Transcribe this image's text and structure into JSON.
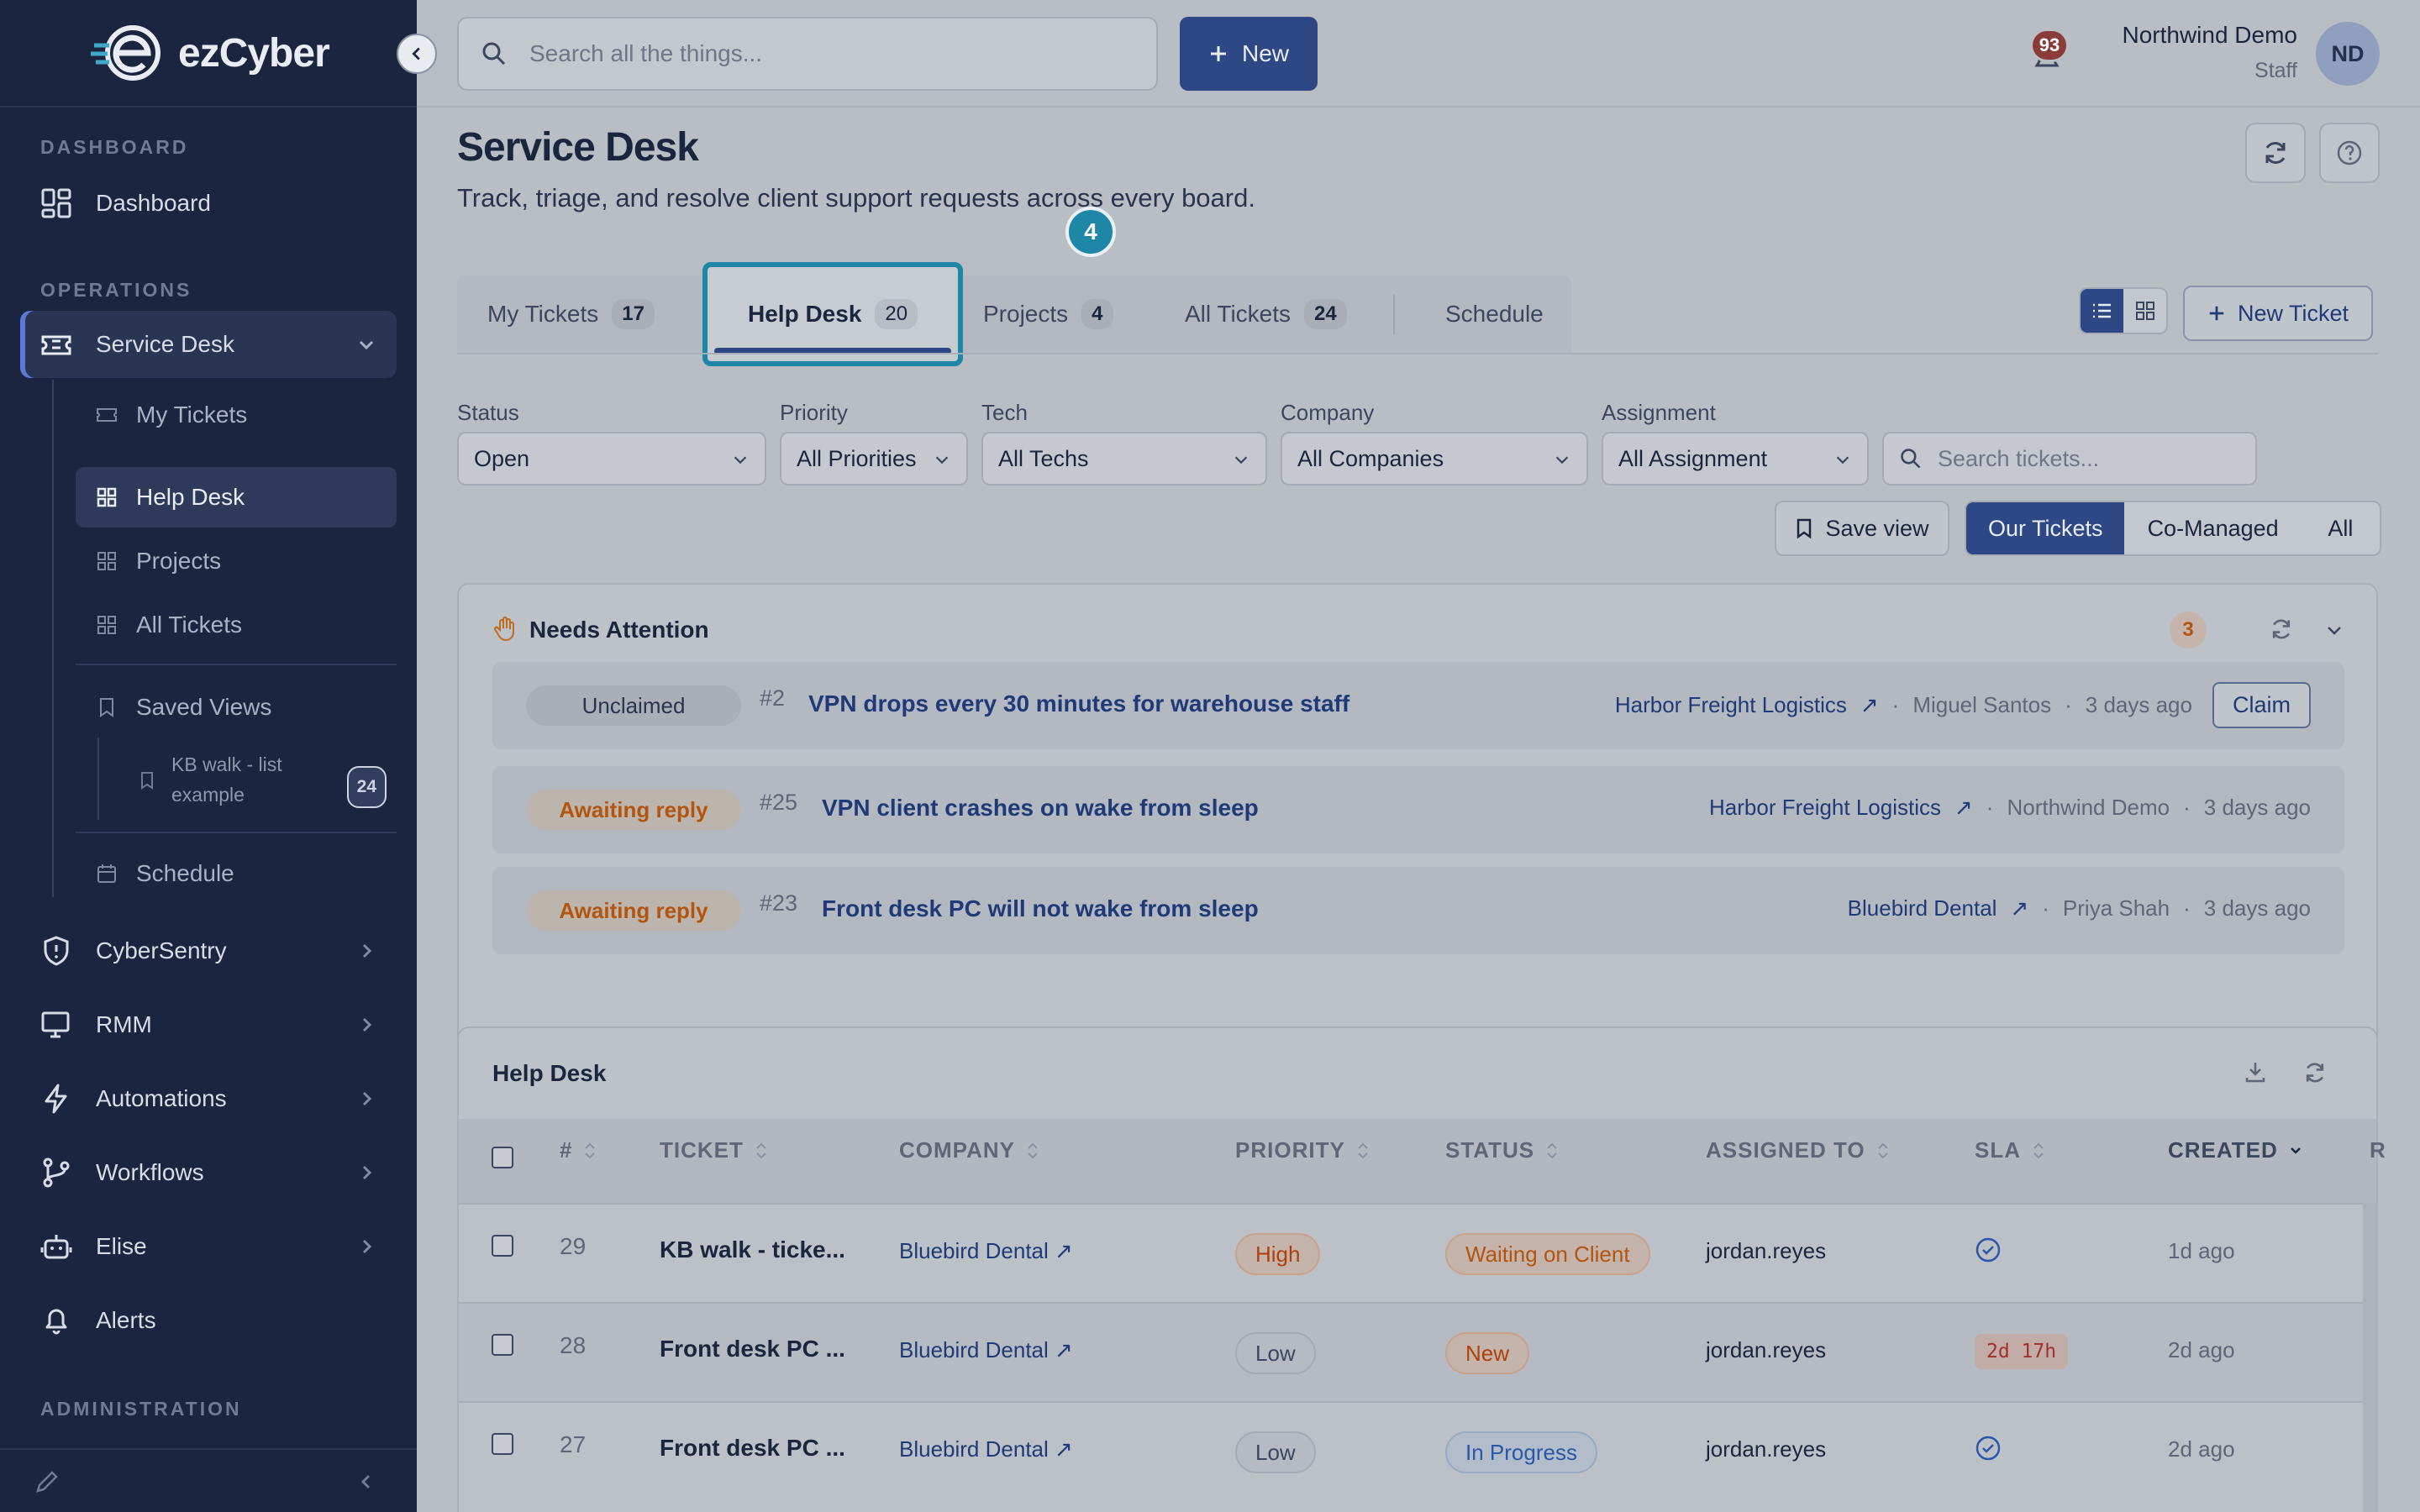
{
  "brand": {
    "name": "ezCyber"
  },
  "sidebar": {
    "sections": {
      "dashboard": "DASHBOARD",
      "operations": "OPERATIONS",
      "administration": "ADMINISTRATION"
    },
    "items": {
      "dashboard": "Dashboard",
      "service_desk": "Service Desk",
      "cybersentry": "CyberSentry",
      "rmm": "RMM",
      "automations": "Automations",
      "workflows": "Workflows",
      "elise": "Elise",
      "alerts": "Alerts"
    },
    "sub_items": {
      "my_tickets": "My Tickets",
      "help_desk": "Help Desk",
      "projects": "Projects",
      "all_tickets": "All Tickets",
      "saved_views": "Saved Views",
      "schedule": "Schedule"
    },
    "saved_view": {
      "line1": "KB walk - list",
      "line2": "example",
      "count": "24"
    }
  },
  "topbar": {
    "search_placeholder": "Search all the things...",
    "new_label": "New",
    "notification_count": "93",
    "user_name": "Northwind Demo",
    "user_role": "Staff",
    "user_initials": "ND"
  },
  "page": {
    "title": "Service Desk",
    "subtitle": "Track, triage, and resolve client support requests across every board.",
    "step_marker": "4"
  },
  "tabs": [
    {
      "label": "My Tickets",
      "count": "17"
    },
    {
      "label": "Help Desk",
      "count": "20"
    },
    {
      "label": "Projects",
      "count": "4"
    },
    {
      "label": "All Tickets",
      "count": "24"
    },
    {
      "label": "Schedule"
    }
  ],
  "new_ticket_label": "New Ticket",
  "filters": {
    "status": {
      "label": "Status",
      "value": "Open"
    },
    "priority": {
      "label": "Priority",
      "value": "All Priorities"
    },
    "tech": {
      "label": "Tech",
      "value": "All Techs"
    },
    "company": {
      "label": "Company",
      "value": "All Companies"
    },
    "assignment": {
      "label": "Assignment",
      "value": "All Assignment"
    },
    "search_placeholder": "Search tickets..."
  },
  "save_view_label": "Save view",
  "scope": {
    "ours": "Our Tickets",
    "comanaged": "Co-Managed",
    "all": "All"
  },
  "attention": {
    "title": "Needs Attention",
    "count": "3",
    "rows": [
      {
        "pill": "Unclaimed",
        "num": "#2",
        "title": "VPN drops every 30 minutes for warehouse staff",
        "company": "Harbor Freight Logistics",
        "person": "Miguel Santos",
        "time": "3 days ago",
        "action": "Claim"
      },
      {
        "pill": "Awaiting reply",
        "num": "#25",
        "title": "VPN client crashes on wake from sleep",
        "company": "Harbor Freight Logistics",
        "person": "Northwind Demo",
        "time": "3 days ago"
      },
      {
        "pill": "Awaiting reply",
        "num": "#23",
        "title": "Front desk PC will not wake from sleep",
        "company": "Bluebird Dental",
        "person": "Priya Shah",
        "time": "3 days ago"
      }
    ]
  },
  "table": {
    "title": "Help Desk",
    "columns": [
      "#",
      "TICKET",
      "COMPANY",
      "PRIORITY",
      "STATUS",
      "ASSIGNED TO",
      "SLA",
      "CREATED",
      "R"
    ],
    "rows": [
      {
        "num": "29",
        "ticket": "KB walk - ticke...",
        "company": "Bluebird Dental",
        "priority": "High",
        "status": "Waiting on Client",
        "assigned": "jordan.reyes",
        "sla": "ok",
        "created": "1d ago"
      },
      {
        "num": "28",
        "ticket": "Front desk PC ...",
        "company": "Bluebird Dental",
        "priority": "Low",
        "status": "New",
        "assigned": "jordan.reyes",
        "sla": "2d 17h",
        "created": "2d ago"
      },
      {
        "num": "27",
        "ticket": "Front desk PC ...",
        "company": "Bluebird Dental",
        "priority": "Low",
        "status": "In Progress",
        "assigned": "jordan.reyes",
        "sla": "ok",
        "created": "2d ago"
      }
    ]
  }
}
